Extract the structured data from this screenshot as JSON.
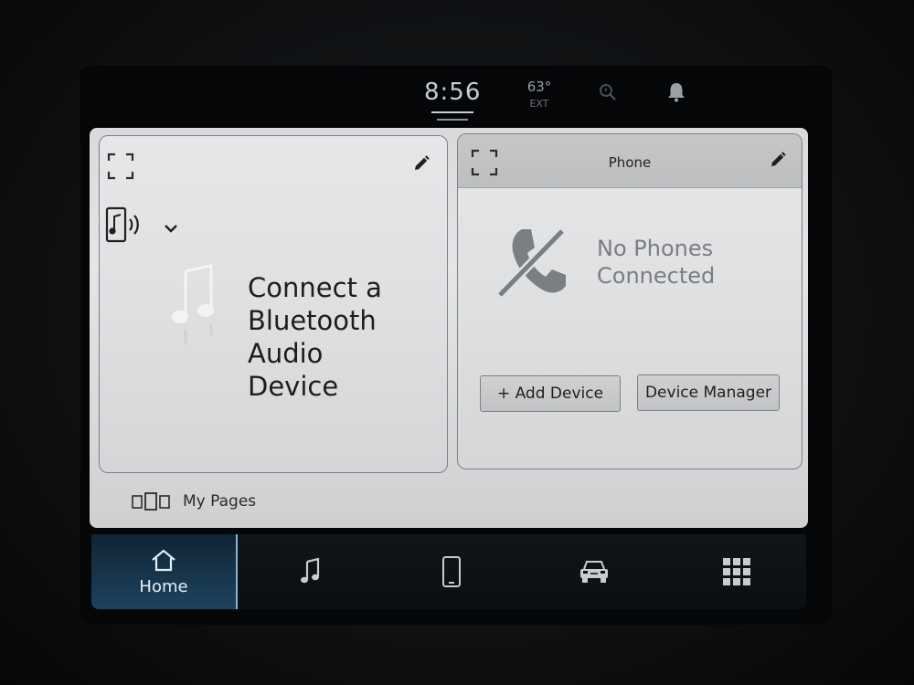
{
  "status": {
    "time": "8:56",
    "temperature": "63°",
    "temperature_unit": "EXT",
    "icons": [
      "voice-search-icon",
      "bell-icon"
    ]
  },
  "audio_card": {
    "source_icon": "phone-audio-icon",
    "message_lines": [
      "Connect a",
      "Bluetooth",
      "Audio",
      "Device"
    ]
  },
  "phone_card": {
    "title": "Phone",
    "message_lines": [
      "No Phones",
      "Connected"
    ],
    "add_device_label": "+ Add Device",
    "device_manager_label": "Device Manager"
  },
  "footer": {
    "my_pages_label": "My Pages"
  },
  "nav": {
    "home_label": "Home",
    "items": [
      "home-icon",
      "music-note-icon",
      "phone-icon",
      "car-icon",
      "apps-grid-icon"
    ]
  },
  "colors": {
    "nav_active": "#1d4360",
    "panel": "#e4e5e6",
    "nav_background": "#0a0f12"
  }
}
